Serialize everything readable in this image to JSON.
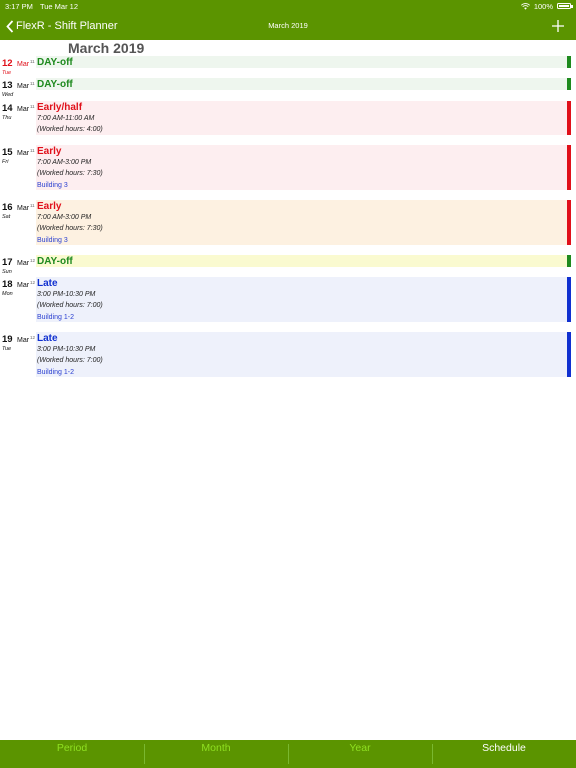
{
  "statusbar": {
    "time": "3:17 PM",
    "date": "Tue Mar 12",
    "battery": "100%"
  },
  "navbar": {
    "back_label": "FlexR - Shift Planner",
    "title": "March 2019"
  },
  "month_header": "March 2019",
  "colors": {
    "accent": "#5b9400",
    "green": "#1e8a1e",
    "red": "#e0101a",
    "blue": "#1030d0"
  },
  "days": [
    {
      "day": "12",
      "mon": "Mar",
      "weekday": "Tue",
      "week": "11",
      "shift": "DAY-off",
      "time": "",
      "worked": "",
      "location": "",
      "today": true,
      "type": "off"
    },
    {
      "day": "13",
      "mon": "Mar",
      "weekday": "Wed",
      "week": "11",
      "shift": "DAY-off",
      "time": "",
      "worked": "",
      "location": "",
      "type": "off"
    },
    {
      "day": "14",
      "mon": "Mar",
      "weekday": "Thu",
      "week": "11",
      "shift": "Early/half",
      "time": "7:00 AM-11:00 AM",
      "worked": "(Worked hours: 4:00)",
      "location": "",
      "type": "early"
    },
    {
      "day": "15",
      "mon": "Mar",
      "weekday": "Fri",
      "week": "11",
      "shift": "Early",
      "time": "7:00 AM-3:00 PM",
      "worked": "(Worked hours: 7:30)",
      "location": "Building 3",
      "type": "early"
    },
    {
      "day": "16",
      "mon": "Mar",
      "weekday": "Sat",
      "week": "11",
      "shift": "Early",
      "time": "7:00 AM-3:00 PM",
      "worked": "(Worked hours: 7:30)",
      "location": "Building 3",
      "type": "early-weekend"
    },
    {
      "day": "17",
      "mon": "Mar",
      "weekday": "Sun",
      "week": "12",
      "shift": "DAY-off",
      "time": "",
      "worked": "",
      "location": "",
      "type": "off-weekend"
    },
    {
      "day": "18",
      "mon": "Mar",
      "weekday": "Mon",
      "week": "12",
      "shift": "Late",
      "time": "3:00 PM-10:30 PM",
      "worked": "(Worked hours: 7:00)",
      "location": "Building 1-2",
      "type": "late"
    },
    {
      "day": "19",
      "mon": "Mar",
      "weekday": "Tue",
      "week": "12",
      "shift": "Late",
      "time": "3:00 PM-10:30 PM",
      "worked": "(Worked hours: 7:00)",
      "location": "Building 1-2",
      "type": "late"
    }
  ],
  "tabs": [
    {
      "label": "Period",
      "active": false
    },
    {
      "label": "Month",
      "active": false
    },
    {
      "label": "Year",
      "active": false
    },
    {
      "label": "Schedule",
      "active": true
    }
  ]
}
